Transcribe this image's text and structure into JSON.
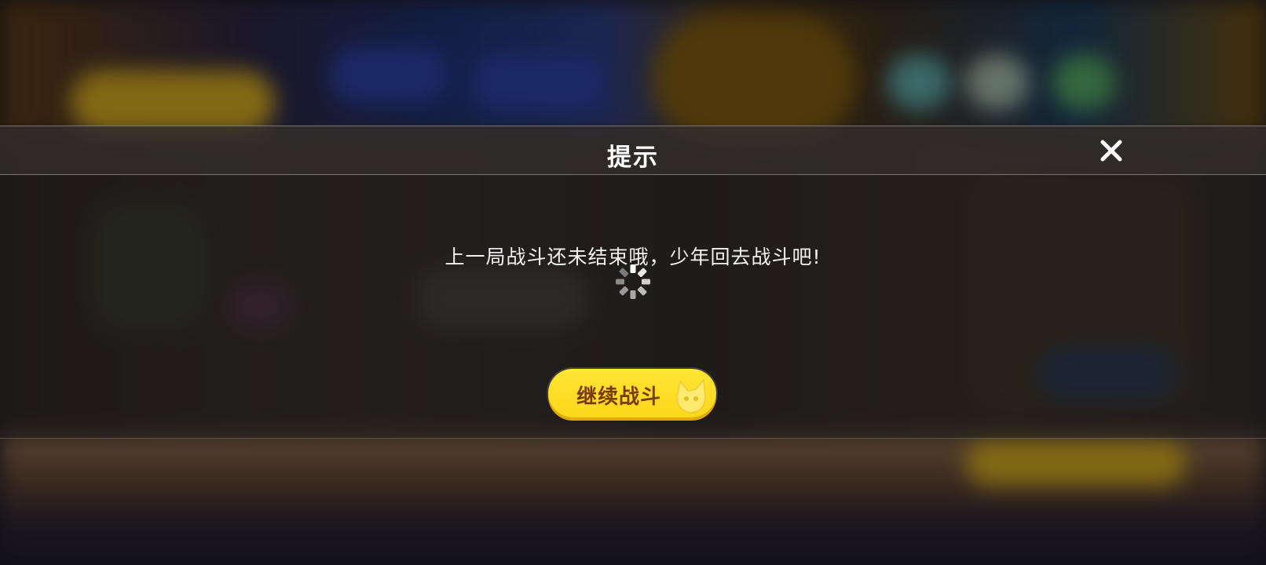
{
  "dialog": {
    "title": "提示",
    "message": "上一局战斗还未结束哦，少年回去战斗吧!",
    "continue_button_label": "继续战斗"
  },
  "icons": {
    "close": "close-icon",
    "loading": "loading-spinner-icon",
    "button_decoration": "mascot-icon"
  },
  "colors": {
    "button": "#fdd71a",
    "button_text": "#7a3b08",
    "title_text": "#ffffff"
  }
}
